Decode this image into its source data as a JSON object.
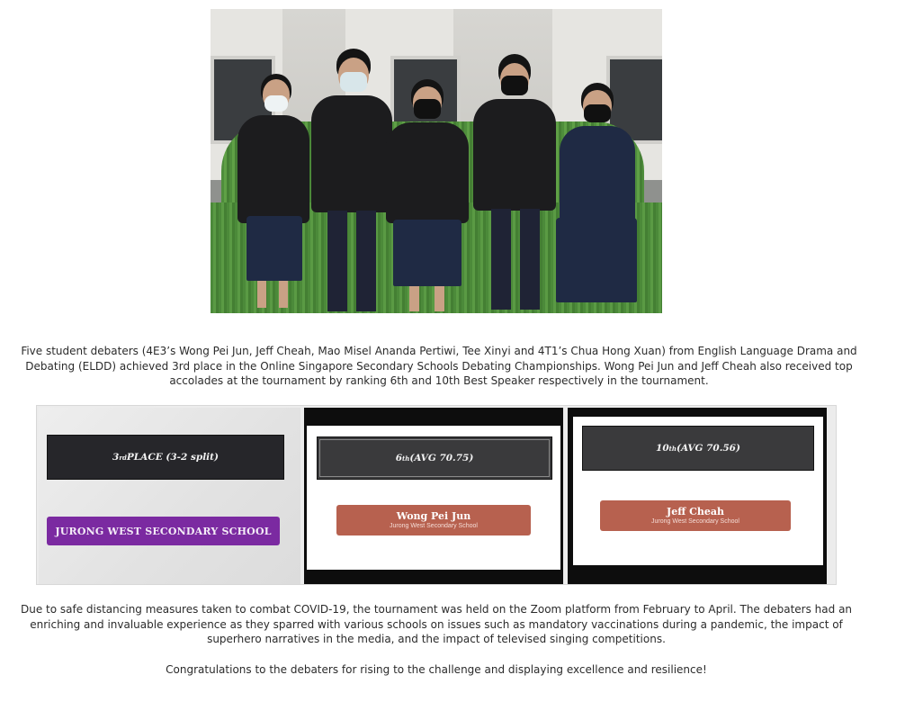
{
  "photo": {
    "people": [
      {
        "id": "student-1"
      },
      {
        "id": "student-2"
      },
      {
        "id": "student-3"
      },
      {
        "id": "student-4"
      },
      {
        "id": "student-5"
      }
    ]
  },
  "intro_paragraph": "Five student debaters (4E3’s Wong Pei Jun, Jeff Cheah, Mao Misel Ananda Pertiwi, Tee Xinyi and 4T1’s Chua Hong Xuan) from English Language Drama and Debating (ELDD) achieved 3rd place in the Online Singapore Secondary Schools Debating Championships. Wong Pei Jun and Jeff Cheah also received top accolades at the tournament by ranking 6th and 10th Best Speaker respectively in the tournament.",
  "awards": {
    "team": {
      "rank": "3",
      "rank_suffix": "rd",
      "title_rest": " PLACE (3-2 split)",
      "school": "JURONG WEST SECONDARY SCHOOL",
      "color": "#7b2aa1"
    },
    "speaker1": {
      "rank": "6",
      "rank_suffix": "th",
      "title_rest": " (AVG 70.75)",
      "name": "Wong Pei Jun",
      "school": "Jurong West Secondary School",
      "color": "#b7614f"
    },
    "speaker2": {
      "rank": "10",
      "rank_suffix": "th",
      "title_rest": " (AVG 70.56)",
      "name": "Jeff Cheah",
      "school": "Jurong West Secondary School",
      "color": "#b7614f"
    }
  },
  "body_paragraph": "Due to safe distancing measures taken to combat COVID-19, the tournament was held on the Zoom platform from February to April. The debaters had an enriching and invaluable experience as they sparred with various schools on issues such as mandatory vaccinations during a pandemic, the impact of superhero narratives in the media, and the impact of televised singing competitions.",
  "closing_paragraph": "Congratulations to the debaters for rising to the challenge and displaying excellence and resilience!"
}
